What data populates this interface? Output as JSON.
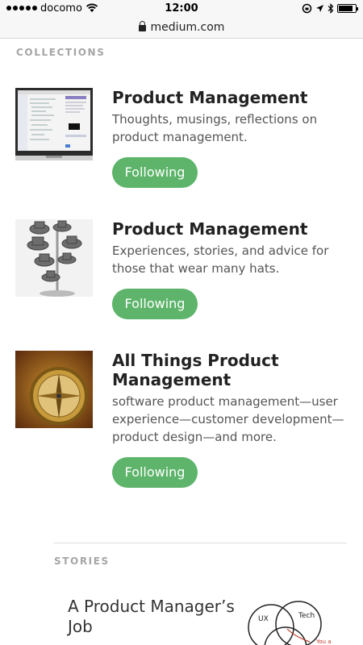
{
  "status_bar": {
    "carrier": "docomo",
    "time": "12:00",
    "signal_dots": 5,
    "battery_level": 0.85
  },
  "browser": {
    "url": "medium.com"
  },
  "collections": {
    "label": "COLLECTIONS",
    "items": [
      {
        "title": "Product Management",
        "description": "Thoughts, musings, reflections on product management.",
        "button_label": "Following",
        "thumbnail": "laptop-screenshot-image"
      },
      {
        "title": "Product Management",
        "description": "Experiences, stories, and advice for those that wear many hats.",
        "button_label": "Following",
        "thumbnail": "stacked-hats-image"
      },
      {
        "title": "All Things Product Management",
        "description": "software product management—user experience—customer development—product design—and more.",
        "button_label": "Following",
        "thumbnail": "compass-image"
      }
    ]
  },
  "stories": {
    "label": "STORIES",
    "items": [
      {
        "title": "A Product Manager’s Job",
        "thumbnail_labels": [
          "UX",
          "Tech",
          "You a"
        ]
      }
    ]
  },
  "colors": {
    "follow_button": "#5db46a",
    "section_label": "#a5a5a5"
  }
}
